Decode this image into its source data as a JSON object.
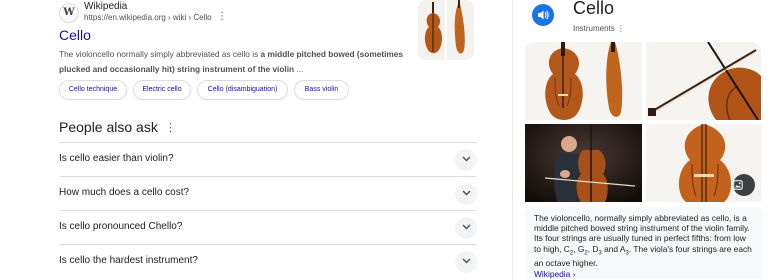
{
  "result": {
    "favicon_letter": "W",
    "site_name": "Wikipedia",
    "site_url": "https://en.wikipedia.org › wiki › Cello",
    "title": "Cello",
    "snippet_part1": "The violoncello normally simply abbreviated as cello is ",
    "snippet_bold": "a middle pitched bowed (sometimes plucked and occasionally hit) string instrument of the violin",
    "snippet_part2": " ...",
    "chips": [
      "Cello technique",
      "Electric cello",
      "Cello (disambiguation)",
      "Bass violin"
    ]
  },
  "people_also_ask": {
    "heading": "People also ask",
    "questions": [
      "Is cello easier than violin?",
      "How much does a cello cost?",
      "Is cello pronounced Chello?",
      "Is cello the hardest instrument?"
    ]
  },
  "knowledge_panel": {
    "title": "Cello",
    "subtitle": "Instruments",
    "description": {
      "text1": "The violoncello, normally simply abbreviated as cello, is a middle pitched bowed string instrument of the violin family. Its four strings are usually tuned in perfect fifths: from low to high, C",
      "sub1": "2",
      "sep1": ", G",
      "sub2": "2",
      "sep2": ", D",
      "sub3": "3",
      "sep3": " and A",
      "sub4": "3",
      "text2": ". The viola's four strings are each an octave higher.",
      "link": "Wikipedia ›"
    }
  },
  "colors": {
    "link": "#1a0dab",
    "accent": "#1a73e8",
    "wood": "#c0651e"
  },
  "icons": {
    "speaker": "speaker-icon",
    "chevron": "chevron-down-icon",
    "image_search": "image-search-icon",
    "more": "more-vert-icon"
  }
}
